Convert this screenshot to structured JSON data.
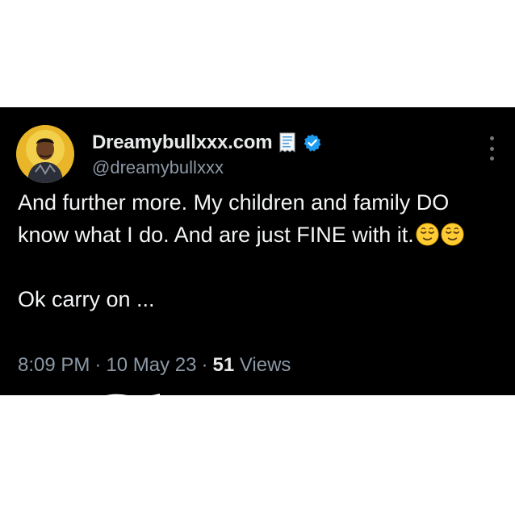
{
  "tweet": {
    "display_name": "Dreamybullxxx.com",
    "handle": "@dreamybullxxx",
    "text_line_1": "And further more. My children and family DO know what I do.  And are just FINE with it.",
    "text_line_2": "Ok carry on ...",
    "time": "8:09 PM",
    "date": "10 May 23",
    "views_count": "51",
    "views_label": "Views",
    "separator": "·",
    "verified_color": "#1d9bf0",
    "emoji": [
      "relieved-face",
      "relieved-face"
    ]
  }
}
